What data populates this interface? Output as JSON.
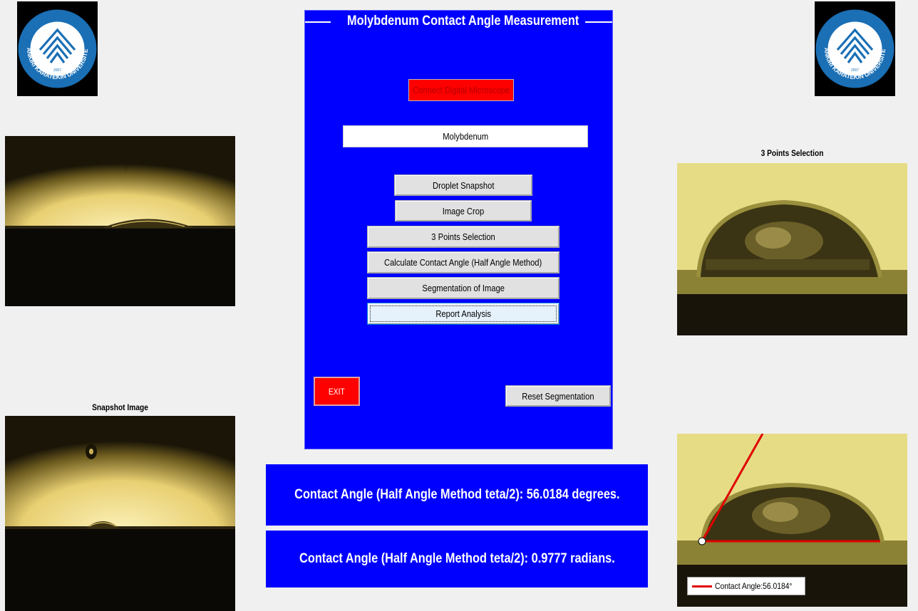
{
  "app": {
    "title": "Molybdenum Contact Angle Measurement"
  },
  "logos": {
    "left_name": "ÇANKIRI KARATEKİN ÜNİVERSİTESİ",
    "right_name": "ÇANKIRI KARATEKİN ÜNİVERSİTESİ",
    "year": "2007"
  },
  "panel": {
    "connect_button": "Connect Digital Microscope",
    "material_field": "Molybdenum",
    "buttons": [
      "Droplet Snapshot",
      "Image Crop",
      "3 Points Selection",
      "Calculate Contact Angle (Half Angle Method)",
      "Segmentation of Image",
      "Report Analysis"
    ],
    "exit_button": "EXIT",
    "reset_button": "Reset Segmentation"
  },
  "images": {
    "snapshot_caption": "Snapshot Image",
    "points_caption": "3 Points Selection",
    "legend_label": "Contact Angle:56.0184°"
  },
  "results": {
    "degrees_text": "Contact Angle (Half Angle Method teta/2): 56.0184 degrees.",
    "radians_text": "Contact Angle (Half Angle Method teta/2): 0.9777 radians."
  },
  "colors": {
    "panel_blue": "#0000ff",
    "exit_red": "#ff0000",
    "angle_line": "#e00000",
    "droplet_glow": "#f5e39a"
  }
}
